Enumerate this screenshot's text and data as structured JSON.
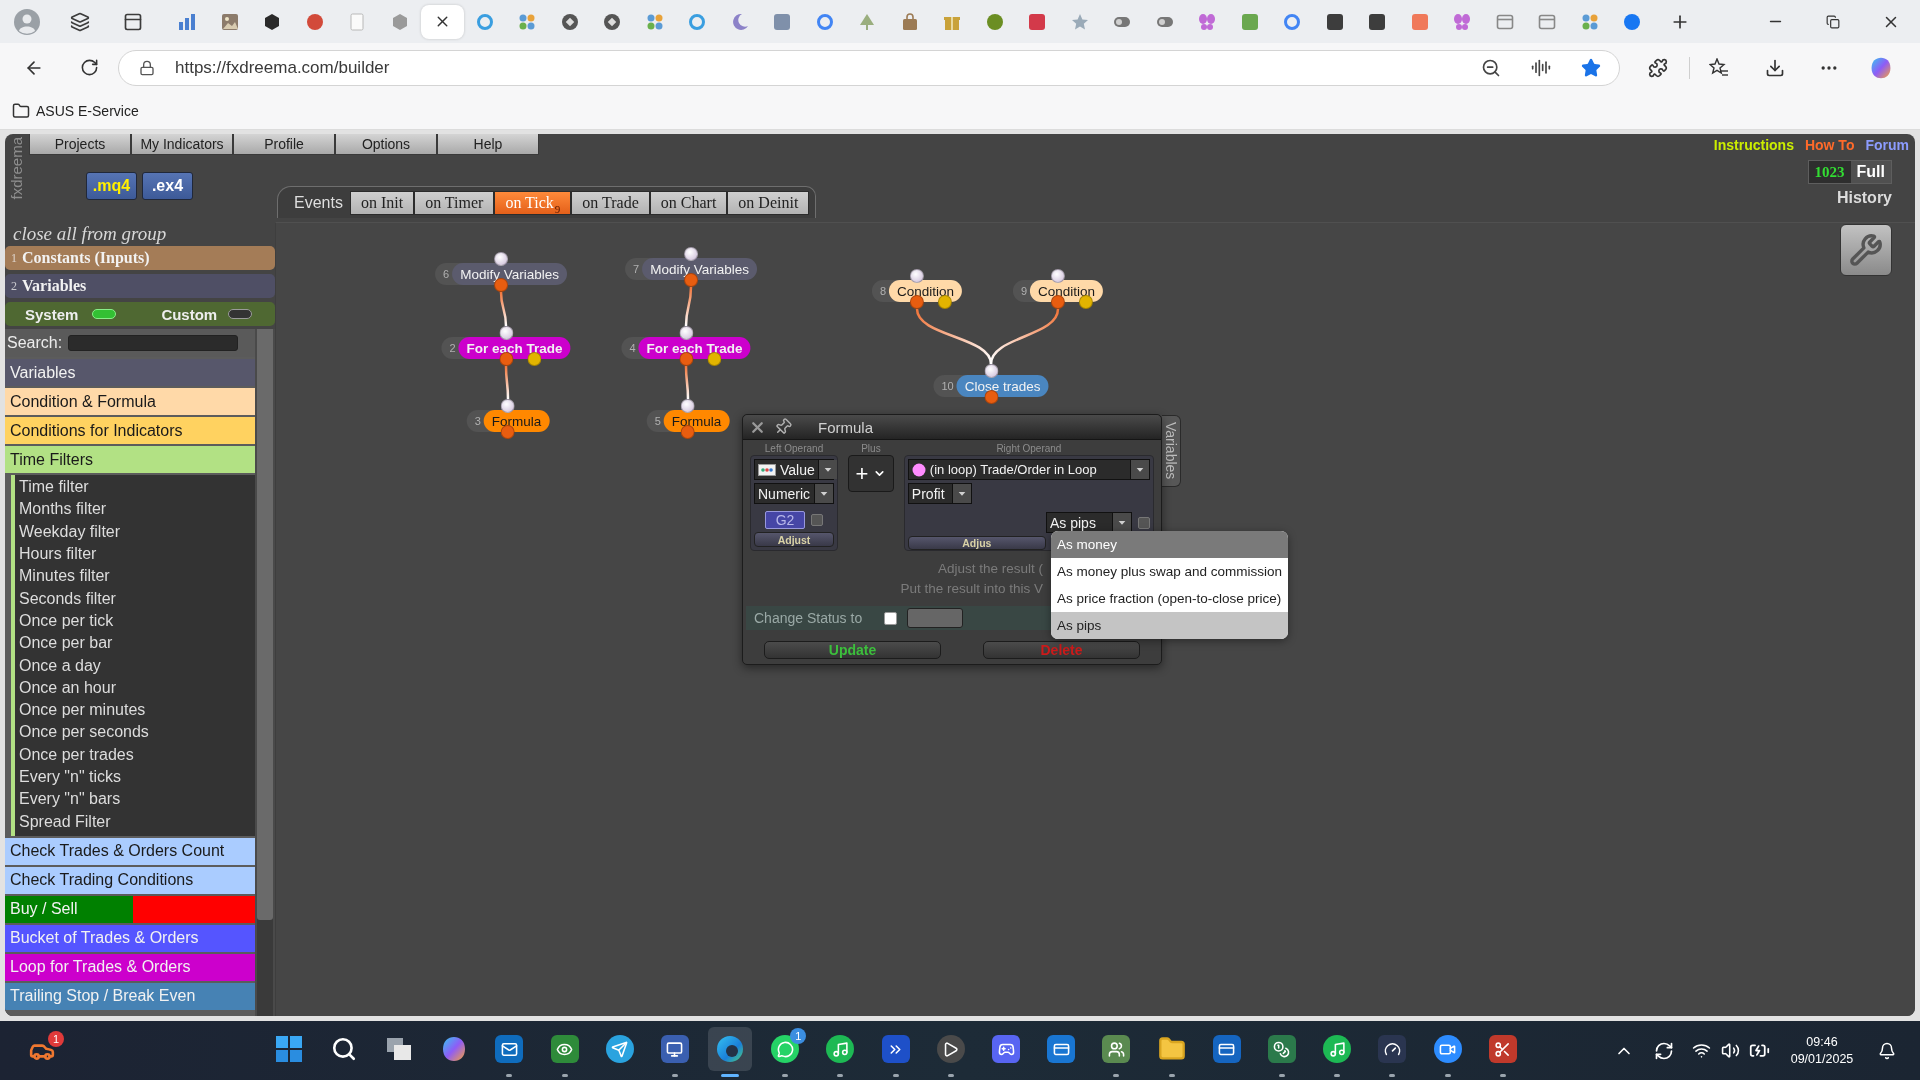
{
  "browser": {
    "tabs": [
      {
        "selected": false
      },
      {
        "selected": false
      },
      {
        "selected": false
      },
      {
        "selected": false
      },
      {
        "selected": false
      },
      {
        "selected": false
      },
      {
        "selected": true
      },
      {
        "selected": false
      },
      {
        "selected": false
      },
      {
        "selected": false
      },
      {
        "selected": false
      },
      {
        "selected": false
      },
      {
        "selected": false
      },
      {
        "selected": false
      },
      {
        "selected": false
      },
      {
        "selected": false
      },
      {
        "selected": false
      },
      {
        "selected": false
      },
      {
        "selected": false
      },
      {
        "selected": false
      },
      {
        "selected": false
      },
      {
        "selected": false
      },
      {
        "selected": false
      },
      {
        "selected": false
      },
      {
        "selected": false
      },
      {
        "selected": false
      },
      {
        "selected": false
      },
      {
        "selected": false
      },
      {
        "selected": false
      },
      {
        "selected": false
      },
      {
        "selected": false
      },
      {
        "selected": false
      },
      {
        "selected": false
      },
      {
        "selected": false
      },
      {
        "selected": false
      }
    ],
    "url": "https://fxdreema.com/builder",
    "bookmarks": [
      {
        "label": "ASUS E-Service"
      }
    ]
  },
  "app": {
    "logo": "fxdreema",
    "menu": [
      "Projects",
      "My Indicators",
      "Profile",
      "Options",
      "Help"
    ],
    "file_buttons": [
      {
        "label": ".mq4",
        "kind": "source"
      },
      {
        "label": ".ex4",
        "kind": "compiled"
      }
    ],
    "events_label": "Events",
    "event_tabs": [
      {
        "label": "on Init",
        "selected": false
      },
      {
        "label": "on Timer",
        "selected": false
      },
      {
        "label": "on Tick",
        "selected": true,
        "count": "9"
      },
      {
        "label": "on Trade",
        "selected": false
      },
      {
        "label": "on Chart",
        "selected": false
      },
      {
        "label": "on Deinit",
        "selected": false
      }
    ],
    "links": [
      {
        "label": "Instructions",
        "color": "#ccee00"
      },
      {
        "label": "How To",
        "color": "#ff6a2a"
      },
      {
        "label": "Forum",
        "color": "#8c9cff"
      }
    ],
    "counter": "1023",
    "view_mode": "Full",
    "history": "History"
  },
  "sidebar": {
    "project": "close all from group",
    "sections": [
      {
        "number": "1",
        "label": "Constants (Inputs)",
        "color": "#a47c57"
      },
      {
        "number": "2",
        "label": "Variables",
        "color": "#4f4f65"
      }
    ],
    "toggles": [
      {
        "label": "System",
        "on": true
      },
      {
        "label": "Custom",
        "on": false
      }
    ],
    "search": {
      "label": "Search:"
    },
    "categories": [
      {
        "label": "Variables",
        "color": "#57576b"
      },
      {
        "label": "Condition & Formula",
        "color": "#ffd9a8"
      },
      {
        "label": "Conditions for Indicators",
        "color": "#ffd260"
      },
      {
        "label": "Time Filters",
        "color": "#b2e184",
        "children": [
          "Time filter",
          "Months filter",
          "Weekday filter",
          "Hours filter",
          "Minutes filter",
          "Seconds filter",
          "Once per tick",
          "Once per bar",
          "Once a day",
          "Once an hour",
          "Once per minutes",
          "Once per seconds",
          "Once per trades",
          "Every \"n\" ticks",
          "Every \"n\" bars",
          "Spread Filter"
        ]
      },
      {
        "label": "Check Trades & Orders Count",
        "color": "#aaccff"
      },
      {
        "label": "Check Trading Conditions",
        "color": "#aaccff"
      },
      {
        "label": "Buy / Sell",
        "color": "#008000",
        "accent": {
          "color": "#ff0000"
        }
      },
      {
        "label": "Bucket of Trades & Orders",
        "color": "#5555ff"
      },
      {
        "label": "Loop for Trades & Orders",
        "color": "#cc00cc"
      },
      {
        "label": "Trailing Stop / Break Even",
        "color": "#4682b4"
      }
    ]
  },
  "canvas": {
    "nodes": [
      {
        "number": "6",
        "label": "Modify Variables",
        "kind": "action",
        "color": "#5b5b6d"
      },
      {
        "number": "2",
        "label": "For each Trade",
        "kind": "loop",
        "color": "#cc00cc"
      },
      {
        "number": "3",
        "label": "Formula",
        "kind": "action",
        "color": "#ff8800"
      },
      {
        "number": "7",
        "label": "Modify Variables",
        "kind": "action",
        "color": "#5b5b6d"
      },
      {
        "number": "4",
        "label": "For each Trade",
        "kind": "loop",
        "color": "#cc00cc"
      },
      {
        "number": "5",
        "label": "Formula",
        "kind": "action",
        "color": "#ff8800"
      },
      {
        "number": "8",
        "label": "Condition",
        "kind": "condition",
        "color": "#ffd9a8"
      },
      {
        "number": "9",
        "label": "Condition",
        "kind": "condition",
        "color": "#ffd9a8"
      },
      {
        "number": "10",
        "label": "Close trades",
        "kind": "action",
        "color": "#4a86c0"
      }
    ]
  },
  "dialog": {
    "title": "Formula",
    "side_tab": "Variables",
    "left_operand": {
      "heading": "Left Operand",
      "source": "Value",
      "type": "Numeric",
      "value": "G2",
      "checked": false,
      "adjust": "Adjust"
    },
    "operator": {
      "heading": "Plus",
      "symbol": "+"
    },
    "right_operand": {
      "heading": "Right Operand",
      "source": "(in loop) Trade/Order in Loop",
      "property": "Profit",
      "mode": "As pips",
      "checked": false,
      "adjust": "Adjus"
    },
    "notes": [
      "Adjust the result (",
      "Put the result into this V"
    ],
    "status": {
      "label": "Change Status to",
      "checked": false
    },
    "buttons": [
      {
        "label": "Update",
        "kind": "confirm"
      },
      {
        "label": "Delete",
        "kind": "danger"
      }
    ],
    "menu": [
      {
        "label": "As money",
        "highlighted": true,
        "selected": false
      },
      {
        "label": "As money plus swap and commission",
        "highlighted": false,
        "selected": false
      },
      {
        "label": "As price fraction (open-to-close price)",
        "highlighted": false,
        "selected": false
      },
      {
        "label": "As pips",
        "highlighted": false,
        "selected": true
      }
    ]
  },
  "taskbar": {
    "widget_badge": "1",
    "apps": [
      {
        "running": false,
        "selected": false
      },
      {
        "running": false,
        "selected": false
      },
      {
        "running": false,
        "selected": false
      },
      {
        "running": false,
        "selected": false
      },
      {
        "running": true,
        "selected": false
      },
      {
        "running": true,
        "selected": false
      },
      {
        "running": false,
        "selected": false
      },
      {
        "running": true,
        "selected": false
      },
      {
        "running": true,
        "selected": true
      },
      {
        "running": true,
        "selected": false,
        "badge": "1"
      },
      {
        "running": true,
        "selected": false
      },
      {
        "running": true,
        "selected": false
      },
      {
        "running": true,
        "selected": false
      },
      {
        "running": false,
        "selected": false
      },
      {
        "running": false,
        "selected": false
      },
      {
        "running": true,
        "selected": false
      },
      {
        "running": true,
        "selected": false
      },
      {
        "running": false,
        "selected": false
      },
      {
        "running": true,
        "selected": false
      },
      {
        "running": true,
        "selected": false
      },
      {
        "running": true,
        "selected": false
      },
      {
        "running": true,
        "selected": false
      },
      {
        "running": true,
        "selected": false
      }
    ],
    "time": "09:46",
    "date": "09/01/2025"
  }
}
